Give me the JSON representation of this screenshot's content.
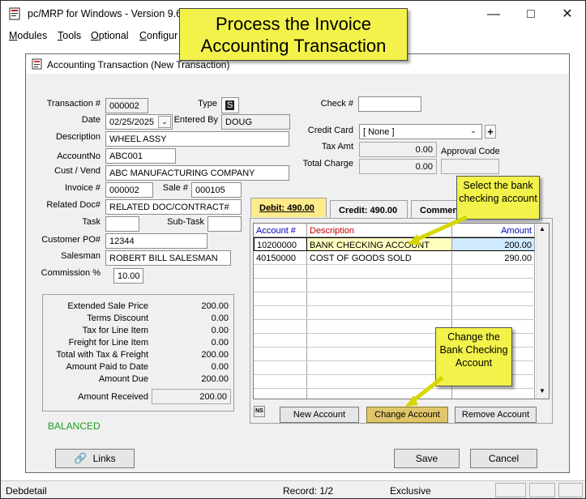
{
  "app": {
    "title": "pc/MRP for Windows - Version 9.60"
  },
  "menus": [
    {
      "label": "Modules",
      "key": "M",
      "rest": "odules"
    },
    {
      "label": "Tools",
      "key": "T",
      "rest": "ools"
    },
    {
      "label": "Optional",
      "key": "O",
      "rest": "ptional"
    },
    {
      "label": "Configur",
      "key": "C",
      "rest": "onfigur"
    }
  ],
  "inner_window": {
    "title": "Accounting Transaction  (New Transaction)"
  },
  "form": {
    "transaction_label": "Transaction #",
    "transaction_value": "000002",
    "type_label": "Type",
    "type_value": "S",
    "date_label": "Date",
    "date_value": "02/25/2025",
    "entered_by_label": "Entered By",
    "entered_by_value": "DOUG",
    "description_label": "Description",
    "description_value": "WHEEL ASSY",
    "accountno_label": "AccountNo",
    "accountno_value": "ABC001",
    "custvend_label": "Cust / Vend",
    "custvend_value": "ABC MANUFACTURING COMPANY",
    "invoice_label": "Invoice #",
    "invoice_value": "000002",
    "sale_label": "Sale #",
    "sale_value": "000105",
    "related_label": "Related Doc#",
    "related_value": "RELATED DOC/CONTRACT#",
    "task_label": "Task",
    "task_value": "",
    "subtask_label": "Sub-Task",
    "subtask_value": "",
    "custpo_label": "Customer PO#",
    "custpo_value": "12344",
    "salesman_label": "Salesman",
    "salesman_value": "ROBERT BILL SALESMAN",
    "commission_label": "Commission %",
    "commission_value": "10.00",
    "check_label": "Check #",
    "check_value": "",
    "creditcard_label": "Credit Card",
    "creditcard_value": "[ None ]",
    "taxamt_label": "Tax Amt",
    "taxamt_value": "0.00",
    "approval_label": "Approval Code",
    "approval_value": "",
    "totalcharge_label": "Total Charge",
    "totalcharge_value": "0.00"
  },
  "totals": [
    {
      "label": "Extended Sale Price",
      "value": "200.00"
    },
    {
      "label": "Terms Discount",
      "value": "0.00"
    },
    {
      "label": "Tax for Line Item",
      "value": "0.00"
    },
    {
      "label": "Freight for Line Item",
      "value": "0.00"
    },
    {
      "label": "Total with Tax & Freight",
      "value": "200.00"
    },
    {
      "label": "Amount Paid to Date",
      "value": "0.00"
    },
    {
      "label": "Amount Due",
      "value": "200.00"
    }
  ],
  "amount_received": {
    "label": "Amount Received",
    "value": "200.00"
  },
  "status_balanced": "BALANCED",
  "tabs": {
    "debit": "Debit:  490.00",
    "credit": "Credit:  490.00",
    "comments": "Comments"
  },
  "grid": {
    "headers": {
      "account": "Account #",
      "description": "Description",
      "amount": "Amount"
    },
    "rows": [
      {
        "account": "10200000",
        "description": "BANK CHECKING ACCOUNT",
        "amount": "200.00"
      },
      {
        "account": "40150000",
        "description": "COST OF GOODS SOLD",
        "amount": "290.00"
      }
    ],
    "ns_label": "NS"
  },
  "buttons": {
    "new_account": "New Account",
    "change_account": "Change Account",
    "remove_account": "Remove Account",
    "links": "Links",
    "save": "Save",
    "cancel": "Cancel"
  },
  "callouts": {
    "title": "Process the Invoice Accounting Transaction",
    "select": "Select the bank checking account",
    "change": "Change the Bank Checking Account"
  },
  "statusbar": {
    "left": "Debdetail",
    "record": "Record: 1/2",
    "mode": "Exclusive"
  },
  "colors": {
    "callout": "#f2f24a",
    "balanced": "#1a9e1a",
    "arrow": "#d6d600",
    "selected_row": "#cfe9ff"
  }
}
